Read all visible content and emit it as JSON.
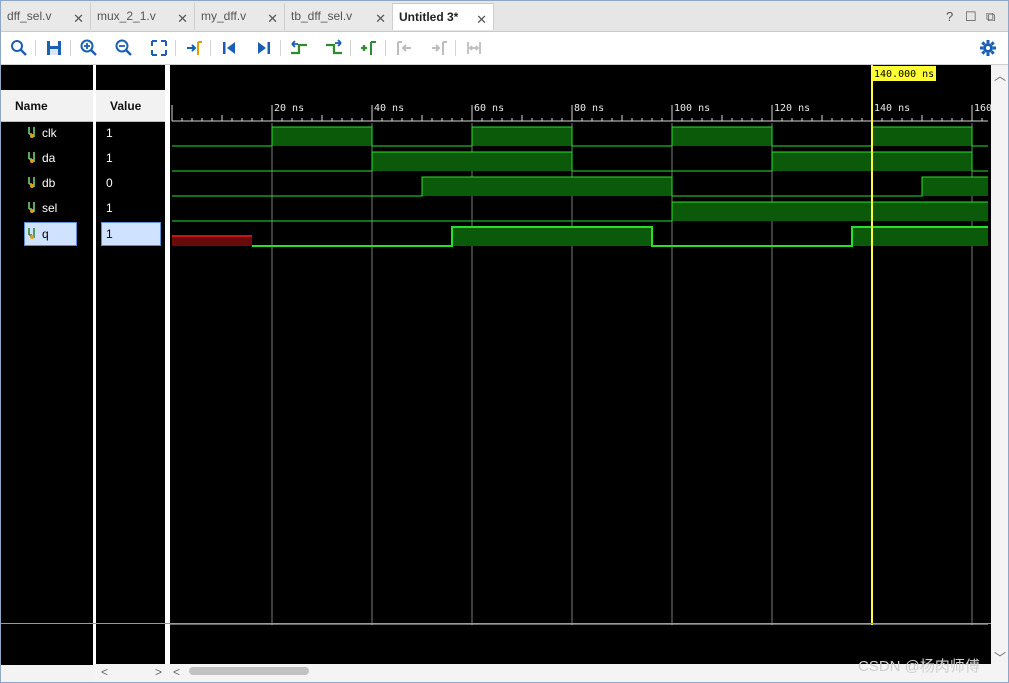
{
  "tabs": [
    {
      "label": "dff_sel.v",
      "active": false
    },
    {
      "label": "mux_2_1.v",
      "active": false
    },
    {
      "label": "my_dff.v",
      "active": false
    },
    {
      "label": "tb_dff_sel.v",
      "active": false
    },
    {
      "label": "Untitled 3*",
      "active": true
    }
  ],
  "window_controls": {
    "help": "?",
    "restore": "☐",
    "popout": "⧉"
  },
  "toolbar": {
    "icons": [
      "search-icon",
      "save-icon",
      "zoom-in-icon",
      "zoom-out-icon",
      "zoom-fit-icon",
      "go-to-cursor-icon",
      "go-to-time-0-icon",
      "go-to-last-time-icon",
      "previous-transition-icon",
      "next-transition-icon",
      "add-marker-icon",
      "previous-marker-icon",
      "next-marker-icon",
      "swap-cursors-icon",
      "settings-icon"
    ]
  },
  "columns": {
    "name": "Name",
    "value": "Value"
  },
  "signals": [
    {
      "name": "clk",
      "value": "1",
      "selected": false
    },
    {
      "name": "da",
      "value": "1",
      "selected": false
    },
    {
      "name": "db",
      "value": "0",
      "selected": false
    },
    {
      "name": "sel",
      "value": "1",
      "selected": false
    },
    {
      "name": "q",
      "value": "1",
      "selected": true
    }
  ],
  "timeline": {
    "ticks": [
      "20 ns",
      "40 ns",
      "60 ns",
      "80 ns",
      "100 ns",
      "120 ns",
      "140 ns",
      "160 ns"
    ],
    "cursor_label": "140.000 ns",
    "cursor_time_ns": 140
  },
  "waveforms": {
    "clk": [
      [
        0,
        0
      ],
      [
        20,
        1
      ],
      [
        40,
        0
      ],
      [
        60,
        1
      ],
      [
        80,
        0
      ],
      [
        100,
        1
      ],
      [
        120,
        0
      ],
      [
        140,
        1
      ],
      [
        160,
        0
      ]
    ],
    "da": [
      [
        0,
        0
      ],
      [
        40,
        1
      ],
      [
        80,
        0
      ],
      [
        120,
        1
      ],
      [
        160,
        0
      ]
    ],
    "db": [
      [
        0,
        0
      ],
      [
        50,
        1
      ],
      [
        100,
        0
      ],
      [
        150,
        1
      ]
    ],
    "sel": [
      [
        0,
        0
      ],
      [
        100,
        1
      ]
    ],
    "q": [
      [
        0,
        "x"
      ],
      [
        16,
        0
      ],
      [
        56,
        1
      ],
      [
        96,
        0
      ],
      [
        136,
        1
      ]
    ]
  },
  "watermark": "CSDN @杨肉师傅",
  "colors": {
    "high_fill": "#0a5a0a",
    "line": "#28e028",
    "unknown": "#c81414",
    "cursor": "#ffff33",
    "grid": "#7a7a7a"
  }
}
